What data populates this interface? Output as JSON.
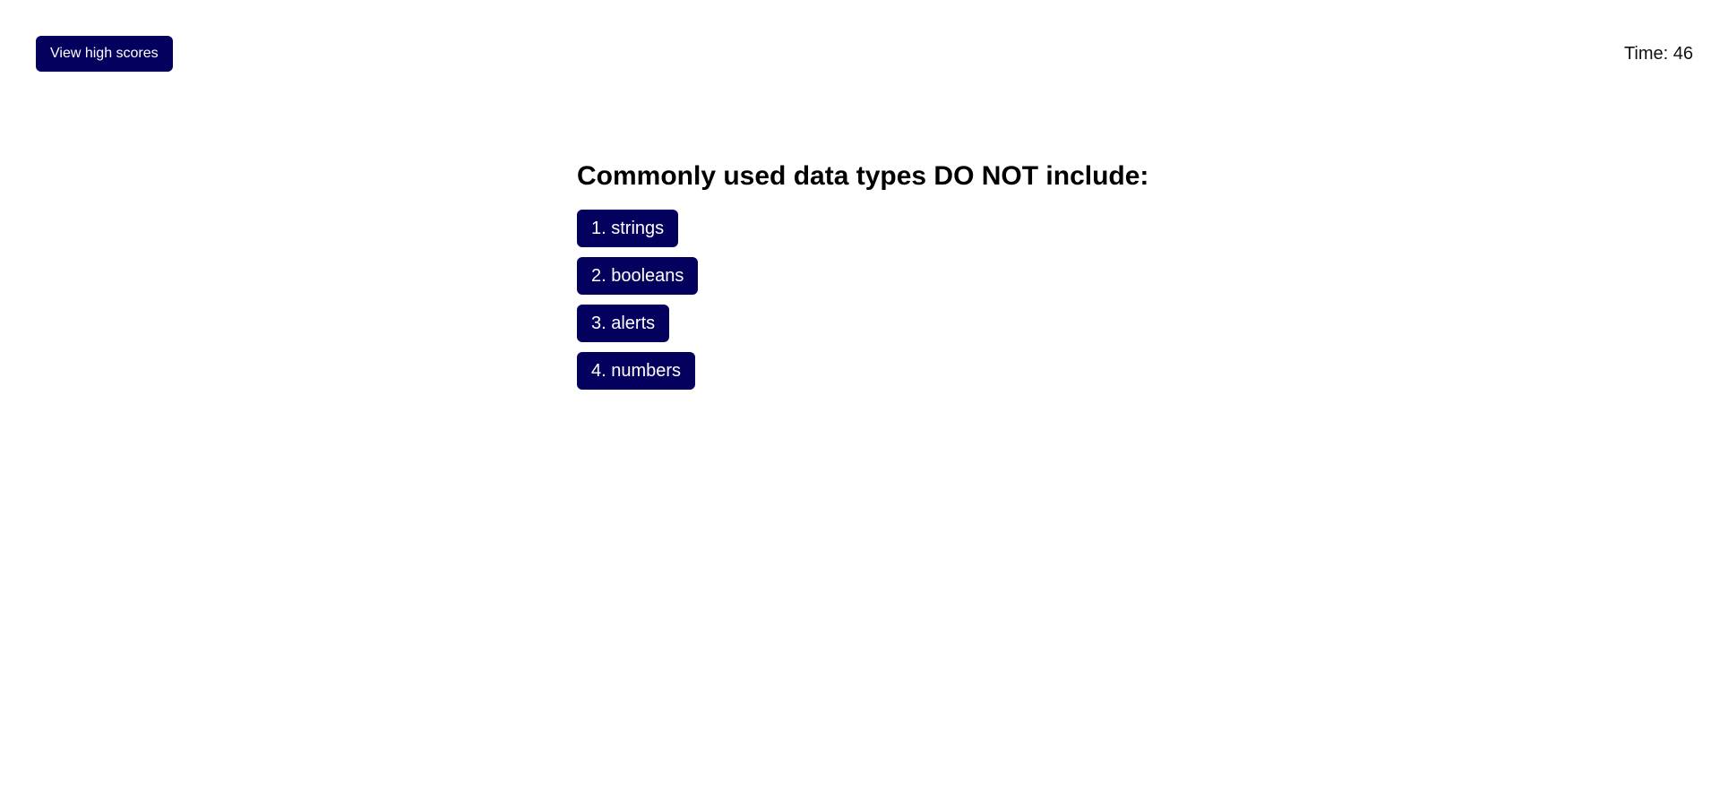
{
  "header": {
    "high_scores_label": "View high scores",
    "timer_text": "Time: 46"
  },
  "quiz": {
    "question": "Commonly used data types DO NOT include:",
    "choices": [
      {
        "label": "1. strings"
      },
      {
        "label": "2. booleans"
      },
      {
        "label": "3. alerts"
      },
      {
        "label": "4. numbers"
      }
    ]
  },
  "colors": {
    "button_background": "#04005e",
    "button_text": "#ffffff",
    "page_background": "#ffffff",
    "text": "#000000"
  }
}
